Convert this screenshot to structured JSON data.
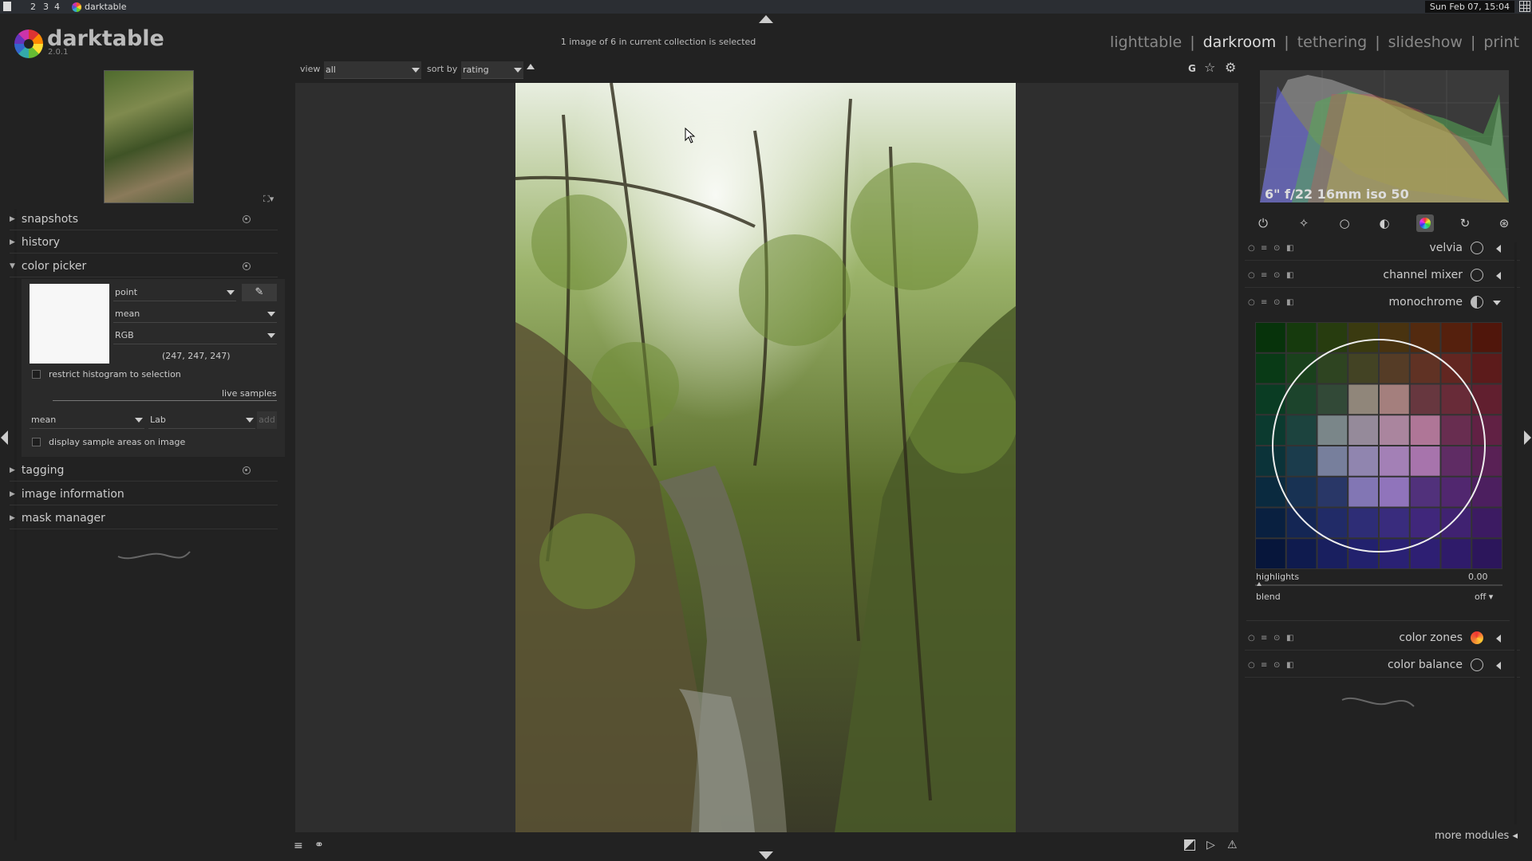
{
  "taskbar": {
    "workspaces": [
      "2",
      "3",
      "4"
    ],
    "app_title": "darktable",
    "clock": "Sun Feb 07, 15:04"
  },
  "app": {
    "logo_name": "darktable",
    "version": "2.0.1",
    "status": "1 image of 6 in current collection is selected"
  },
  "views": [
    {
      "label": "lighttable",
      "active": false
    },
    {
      "label": "darkroom",
      "active": true
    },
    {
      "label": "tethering",
      "active": false
    },
    {
      "label": "slideshow",
      "active": false
    },
    {
      "label": "print",
      "active": false
    }
  ],
  "filterbar": {
    "view_label": "view",
    "view_value": "all",
    "sort_label": "sort by",
    "sort_value": "rating",
    "right_letter": "G"
  },
  "left": {
    "sections": {
      "snapshots": "snapshots",
      "history": "history",
      "color_picker": "color picker",
      "tagging": "tagging",
      "image_information": "image information",
      "mask_manager": "mask manager"
    },
    "color_picker": {
      "mode": "point",
      "stat": "mean",
      "colorspace": "RGB",
      "values": "(247, 247, 247)",
      "restrict_label": "restrict histogram to selection",
      "live_samples": "live samples",
      "sample_stat": "mean",
      "sample_space": "Lab",
      "add_label": "add",
      "display_samples_label": "display sample areas on image",
      "swatch_color": "#f7f7f7"
    }
  },
  "right": {
    "exif": "6\" f/22 16mm iso 50",
    "modules": [
      {
        "name": "velvia"
      },
      {
        "name": "channel mixer"
      },
      {
        "name": "monochrome"
      },
      {
        "name": "color zones"
      },
      {
        "name": "color balance"
      }
    ],
    "monochrome": {
      "highlights_label": "highlights",
      "highlights_value": "0.00",
      "blend_label": "blend",
      "blend_value": "off"
    },
    "more_modules": "more modules"
  }
}
